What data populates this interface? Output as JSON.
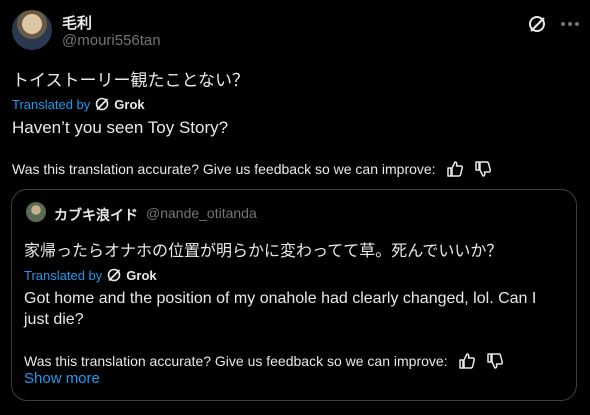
{
  "author": {
    "display_name": "毛利",
    "handle": "@mouri556tan",
    "avatar_icon": "avatar-image"
  },
  "tweet": {
    "text": "トイストーリー観たことない？",
    "translated_by": "Translated by",
    "grok_label": "Grok",
    "translation": "Haven’t you seen Toy Story?",
    "feedback": "Was this translation accurate? Give us feedback so we can improve:"
  },
  "quote": {
    "display_name": "カブキ浪イド",
    "handle": "@nande_otitanda",
    "text": "家帰ったらオナホの位置が明らかに変わってて草。死んでいいか？",
    "translated_by": "Translated by",
    "grok_label": "Grok",
    "translation": "Got home and the position of my onahole had clearly changed, lol. Can I just die?",
    "feedback": "Was this translation accurate? Give us feedback so we can improve:",
    "show_more": "Show more"
  },
  "colors": {
    "background": "#000000",
    "text": "#e7e9ea",
    "muted": "#71767b",
    "accent": "#1d9bf0",
    "border": "#3a3f44"
  }
}
